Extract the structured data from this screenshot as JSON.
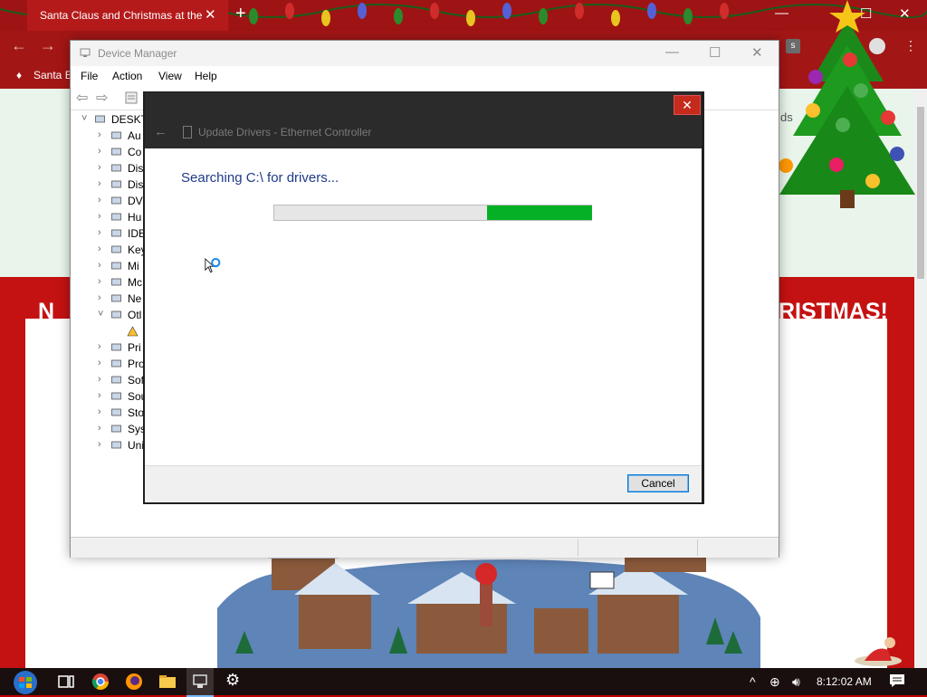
{
  "browser": {
    "tab_title": "Santa Claus and Christmas at the",
    "tab_close": "✕",
    "new_tab": "+",
    "bookmark": "Santa E",
    "profile_letter": "s"
  },
  "page": {
    "banner_left": "N",
    "banner_right": "RISTMAS!",
    "side_text": "ds"
  },
  "device_manager": {
    "title": "Device Manager",
    "menu": [
      "File",
      "Action",
      "View",
      "Help"
    ],
    "tree": [
      {
        "label": "DESKT",
        "expander": "˅",
        "indent": 0
      },
      {
        "label": "Au",
        "expander": "›",
        "indent": 1
      },
      {
        "label": "Co",
        "expander": "›",
        "indent": 1
      },
      {
        "label": "Dis",
        "expander": "›",
        "indent": 1
      },
      {
        "label": "Dis",
        "expander": "›",
        "indent": 1
      },
      {
        "label": "DV",
        "expander": "›",
        "indent": 1
      },
      {
        "label": "Hu",
        "expander": "›",
        "indent": 1
      },
      {
        "label": "IDE",
        "expander": "›",
        "indent": 1
      },
      {
        "label": "Key",
        "expander": "›",
        "indent": 1
      },
      {
        "label": "Mi",
        "expander": "›",
        "indent": 1
      },
      {
        "label": "Mc",
        "expander": "›",
        "indent": 1
      },
      {
        "label": "Ne",
        "expander": "›",
        "indent": 1
      },
      {
        "label": "Otl",
        "expander": "˅",
        "indent": 1
      },
      {
        "label": "",
        "expander": "",
        "indent": 2
      },
      {
        "label": "Pri",
        "expander": "›",
        "indent": 1
      },
      {
        "label": "Pro",
        "expander": "›",
        "indent": 1
      },
      {
        "label": "Sof",
        "expander": "›",
        "indent": 1
      },
      {
        "label": "Sou",
        "expander": "›",
        "indent": 1
      },
      {
        "label": "Sto",
        "expander": "›",
        "indent": 1
      },
      {
        "label": "Sys",
        "expander": "›",
        "indent": 1
      },
      {
        "label": "Uni",
        "expander": "›",
        "indent": 1
      }
    ]
  },
  "dialog": {
    "title": "Update Drivers - Ethernet Controller",
    "close": "✕",
    "back": "←",
    "message": "Searching C:\\ for drivers...",
    "progress": {
      "value": 0.33,
      "start": 0.67
    },
    "cancel_label": "Cancel"
  },
  "taskbar": {
    "clock": "8:12:02 AM"
  },
  "colors": {
    "accent": "#0078d7",
    "progress": "#06b025",
    "page_red": "#c41212",
    "dialog_header": "#2b2b2b"
  }
}
